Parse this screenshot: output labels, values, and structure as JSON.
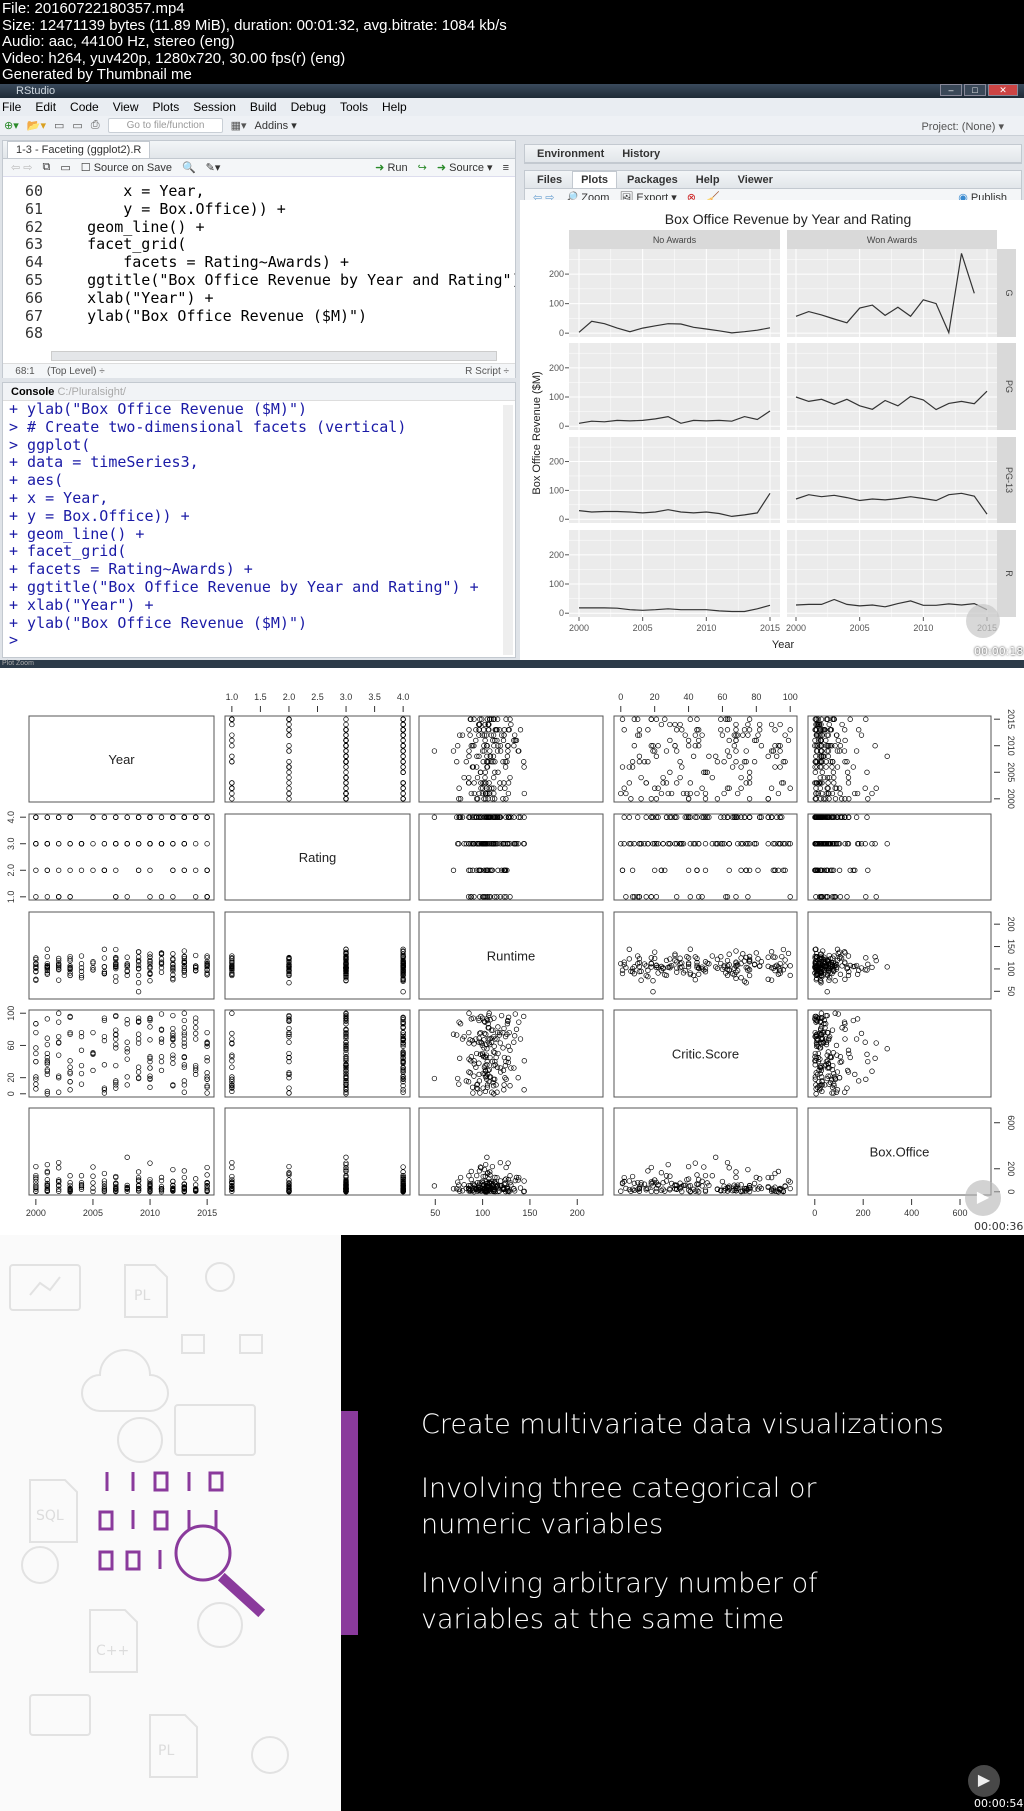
{
  "header": {
    "lines": [
      "File: 20160722180357.mp4",
      "Size: 12471139 bytes (11.89 MiB), duration: 00:01:32, avg.bitrate: 1084 kb/s",
      "Audio: aac, 44100 Hz, stereo (eng)",
      "Video: h264, yuv420p, 1280x720, 30.00 fps(r) (eng)",
      "Generated by Thumbnail me"
    ]
  },
  "rstudio": {
    "window_title": "RStudio",
    "menu": [
      "File",
      "Edit",
      "Code",
      "View",
      "Plots",
      "Session",
      "Build",
      "Debug",
      "Tools",
      "Help"
    ],
    "toolbar": {
      "goto_placeholder": "Go to file/function",
      "addins": "Addins ▾",
      "project": "Project: (None) ▾"
    },
    "editor": {
      "tab": "1-3 - Faceting (ggplot2).R",
      "source_on_save": "Source on Save",
      "run": "Run",
      "source": "Source",
      "lines": [
        {
          "n": "60",
          "t": "        x = Year,"
        },
        {
          "n": "61",
          "t": "        y = Box.Office)) +"
        },
        {
          "n": "62",
          "t": "    geom_line() +"
        },
        {
          "n": "63",
          "t": "    facet_grid("
        },
        {
          "n": "64",
          "t": "        facets = Rating~Awards) +"
        },
        {
          "n": "65",
          "t": "    ggtitle(\"Box Office Revenue by Year and Rating\")"
        },
        {
          "n": "66",
          "t": "    xlab(\"Year\") +"
        },
        {
          "n": "67",
          "t": "    ylab(\"Box Office Revenue ($M)\")"
        },
        {
          "n": "68",
          "t": ""
        }
      ],
      "status_pos": "68:1",
      "status_scope": "(Top Level) ÷",
      "status_type": "R Script ÷"
    },
    "console": {
      "title": "Console",
      "path": "C:/Pluralsight/",
      "lines": [
        "+ ylab(\"Box Office Revenue ($M)\")",
        "> # Create two-dimensional facets (vertical)",
        "> ggplot(",
        "+ data = timeSeries3,",
        "+ aes(",
        "+ x = Year,",
        "+ y = Box.Office)) +",
        "+ geom_line() +",
        "+ facet_grid(",
        "+ facets = Rating~Awards) +",
        "+ ggtitle(\"Box Office Revenue by Year and Rating\") +",
        "+ xlab(\"Year\") +",
        "+ ylab(\"Box Office Revenue ($M)\")",
        ">"
      ]
    },
    "env_tabs": [
      "Environment",
      "History"
    ],
    "files_tabs": [
      "Files",
      "Plots",
      "Packages",
      "Help",
      "Viewer"
    ],
    "plot_toolbar": {
      "zoom": "Zoom",
      "export": "Export ▾",
      "publish": "Publish"
    },
    "timestamp": "00:00:18"
  },
  "plot_zoom": {
    "title": "Plot Zoom",
    "timestamp": "00:00:36"
  },
  "chart_data": [
    {
      "type": "line",
      "title": "Box Office Revenue by Year and Rating",
      "xlabel": "Year",
      "ylabel": "Box Office Revenue ($M)",
      "facet_cols": [
        "No Awards",
        "Won Awards"
      ],
      "facet_rows": [
        "G",
        "PG",
        "PG-13",
        "R"
      ],
      "x": [
        2000,
        2001,
        2002,
        2003,
        2004,
        2005,
        2006,
        2007,
        2008,
        2009,
        2010,
        2011,
        2012,
        2013,
        2014,
        2015
      ],
      "xticks": [
        "2000",
        "2005",
        "2010",
        "2015"
      ],
      "yticks": [
        "0",
        "100",
        "200"
      ],
      "ylim": [
        -13,
        285
      ],
      "grid": true,
      "panels": [
        {
          "row": "G",
          "col": "No Awards",
          "values": [
            3,
            40,
            32,
            17,
            5,
            17,
            25,
            32,
            31,
            20,
            14,
            8,
            1,
            5,
            10,
            18
          ]
        },
        {
          "row": "G",
          "col": "Won Awards",
          "values": [
            57,
            73,
            62,
            48,
            35,
            85,
            95,
            60,
            88,
            57,
            113,
            100,
            2,
            270,
            135,
            null
          ]
        },
        {
          "row": "PG",
          "col": "No Awards",
          "values": [
            10,
            17,
            15,
            20,
            18,
            20,
            25,
            33,
            10,
            20,
            18,
            20,
            17,
            33,
            23,
            52
          ]
        },
        {
          "row": "PG",
          "col": "Won Awards",
          "values": [
            100,
            85,
            92,
            75,
            92,
            70,
            58,
            88,
            70,
            102,
            90,
            57,
            78,
            85,
            77,
            120
          ]
        },
        {
          "row": "PG-13",
          "col": "No Awards",
          "values": [
            30,
            25,
            27,
            27,
            25,
            22,
            25,
            33,
            25,
            22,
            25,
            20,
            10,
            15,
            22,
            90
          ]
        },
        {
          "row": "PG-13",
          "col": "Won Awards",
          "values": [
            70,
            85,
            78,
            83,
            75,
            65,
            70,
            67,
            72,
            78,
            72,
            65,
            85,
            90,
            80,
            18
          ]
        },
        {
          "row": "R",
          "col": "No Awards",
          "values": [
            18,
            18,
            18,
            17,
            12,
            10,
            12,
            15,
            12,
            12,
            12,
            8,
            6,
            6,
            15,
            27
          ]
        },
        {
          "row": "R",
          "col": "Won Awards",
          "values": [
            28,
            30,
            30,
            47,
            30,
            25,
            28,
            22,
            33,
            42,
            27,
            27,
            32,
            28,
            33,
            12
          ]
        }
      ]
    },
    {
      "type": "scatter",
      "variables": [
        "Year",
        "Rating",
        "Runtime",
        "Critic.Score",
        "Box.Office"
      ],
      "ranges": {
        "Year": [
          2000,
          2015
        ],
        "Rating": [
          1,
          4
        ],
        "Runtime": [
          40,
          220
        ],
        "Critic.Score": [
          0,
          100
        ],
        "Box.Office": [
          0,
          700
        ]
      },
      "top_ticks": {
        "Rating": [
          "1.0",
          "1.5",
          "2.0",
          "2.5",
          "3.0",
          "3.5",
          "4.0"
        ],
        "Critic.Score": [
          "0",
          "20",
          "40",
          "60",
          "80",
          "100"
        ]
      },
      "bottom_ticks": {
        "Year": [
          "2000",
          "2005",
          "2010",
          "2015"
        ],
        "Runtime": [
          "50",
          "100",
          "150",
          "200"
        ],
        "Box.Office": [
          "0",
          "200",
          "400",
          "600"
        ]
      },
      "left_ticks": {
        "Rating": [
          "1.0",
          "2.0",
          "3.0",
          "4.0"
        ],
        "Critic.Score": [
          "0",
          "20",
          "60",
          "100"
        ]
      },
      "right_ticks": {
        "Year": [
          "2000",
          "2005",
          "2010",
          "2015"
        ],
        "Runtime": [
          "50",
          "100",
          "150",
          "200"
        ],
        "Box.Office": [
          "0",
          "200",
          "600"
        ]
      }
    }
  ],
  "slide": {
    "bullets": [
      "Create multivariate data visualizations",
      "Involving three categorical or\nnumeric variables",
      "Involving arbitrary number of\nvariables at the same time"
    ],
    "accent": "#8a3a9c",
    "timestamp": "00:00:54"
  }
}
